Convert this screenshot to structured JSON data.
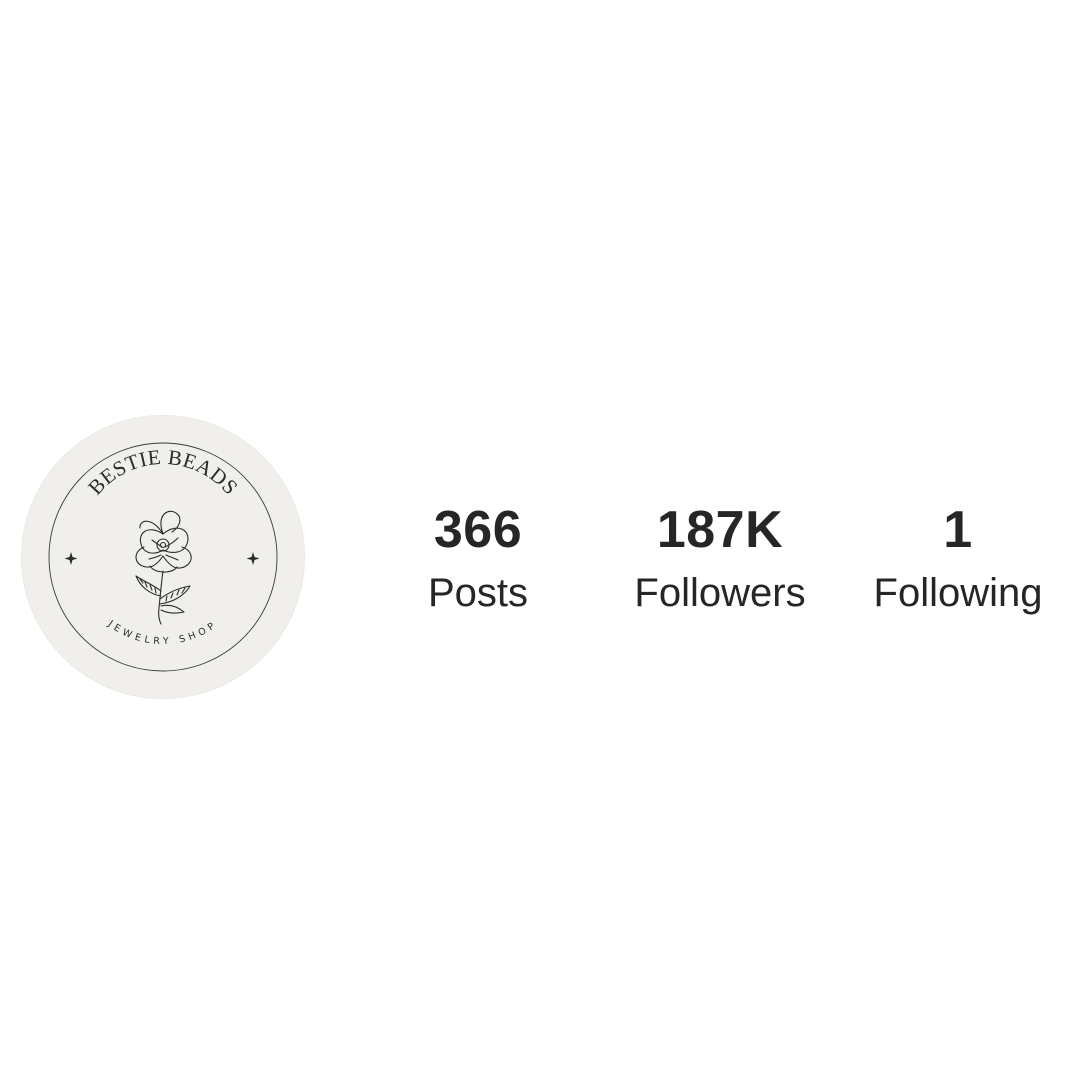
{
  "profile": {
    "avatar": {
      "brand_name": "BESTIE BEADS",
      "tagline": "JEWELRY SHOP",
      "background": "#f1efec",
      "ink": "#2b2b2b"
    },
    "stats": [
      {
        "count": "366",
        "label": "Posts"
      },
      {
        "count": "187K",
        "label": "Followers"
      },
      {
        "count": "1",
        "label": "Following"
      }
    ]
  }
}
